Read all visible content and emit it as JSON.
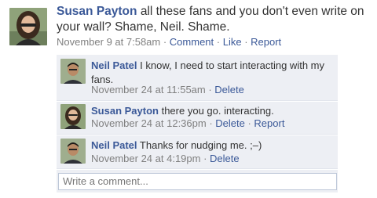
{
  "post": {
    "author": "Susan Payton",
    "text": "all these fans and you don't even write on your wall? Shame, Neil. Shame.",
    "timestamp": "November 9 at 7:58am",
    "actions": {
      "comment": "Comment",
      "like": "Like",
      "report": "Report"
    },
    "separator": " · "
  },
  "comments": [
    {
      "author": "Neil Patel",
      "text": "I know, I need to start interacting with my fans.",
      "timestamp": "November 24 at 11:55am",
      "actions": [
        "Delete"
      ]
    },
    {
      "author": "Susan Payton",
      "text": "there you go. interacting.",
      "timestamp": "November 24 at 12:36pm",
      "actions": [
        "Delete",
        "Report"
      ]
    },
    {
      "author": "Neil Patel",
      "text": "Thanks for nudging me. ;–)",
      "timestamp": "November 24 at 4:19pm",
      "actions": [
        "Delete"
      ]
    }
  ],
  "comment_input": {
    "placeholder": "Write a comment..."
  },
  "colors": {
    "link": "#3b5998",
    "comment_bg": "#edeff4",
    "meta": "#808080"
  }
}
